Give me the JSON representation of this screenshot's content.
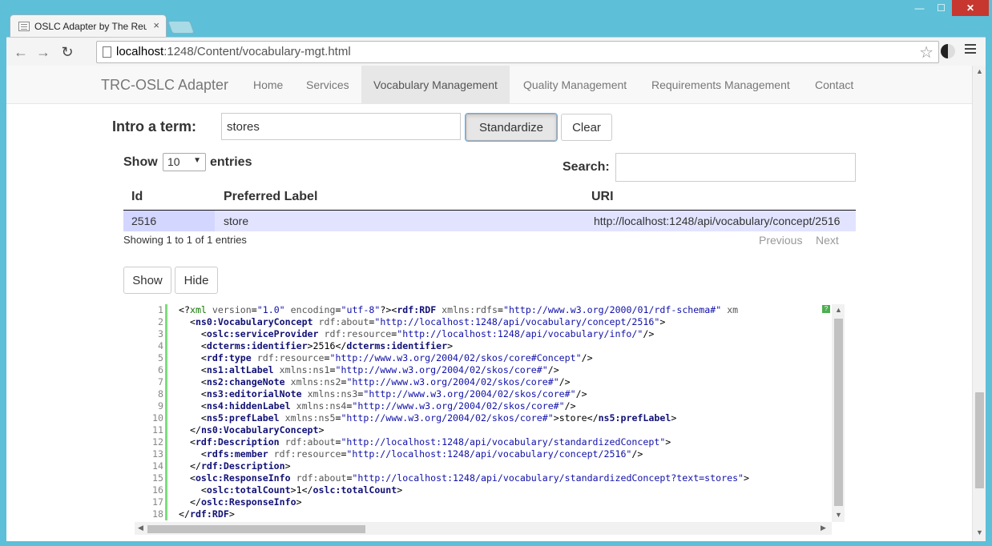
{
  "browser": {
    "tab_title": "OSLC Adapter by The Reu",
    "tab_close": "×",
    "url_host": "localhost",
    "url_rest": ":1248/Content/vocabulary-mgt.html",
    "win_min": "—",
    "win_max": "☐",
    "win_close": "✕",
    "back": "←",
    "forward": "→",
    "reload": "↻",
    "star": "☆"
  },
  "navbar": {
    "brand": "TRC-OSLC Adapter",
    "items": [
      {
        "label": "Home"
      },
      {
        "label": "Services"
      },
      {
        "label": "Vocabulary Management"
      },
      {
        "label": "Quality Management"
      },
      {
        "label": "Requirements Management"
      },
      {
        "label": "Contact"
      }
    ]
  },
  "term": {
    "label": "Intro a term:",
    "value": "stores",
    "standardize": "Standardize",
    "clear": "Clear"
  },
  "table": {
    "show_label": "Show",
    "page_size": "10",
    "entries_label": "entries",
    "search_label": "Search:",
    "columns": [
      "Id",
      "Preferred Label",
      "URI"
    ],
    "rows": [
      {
        "id": "2516",
        "label": "store",
        "uri": "http://localhost:1248/api/vocabulary/concept/2516"
      }
    ],
    "info": "Showing 1 to 1 of 1 entries",
    "previous": "Previous",
    "next": "Next"
  },
  "rdf_buttons": {
    "show": "Show",
    "hide": "Hide"
  },
  "code": {
    "line_numbers": [
      "1",
      "2",
      "3",
      "4",
      "5",
      "6",
      "7",
      "8",
      "9",
      "10",
      "11",
      "12",
      "13",
      "14",
      "15",
      "16",
      "17",
      "18"
    ],
    "lines": [
      "<?xml version=\"1.0\" encoding=\"utf-8\"?><rdf:RDF xmlns:rdfs=\"http://www.w3.org/2000/01/rdf-schema#\" xm",
      "  <ns0:VocabularyConcept rdf:about=\"http://localhost:1248/api/vocabulary/concept/2516\">",
      "    <oslc:serviceProvider rdf:resource=\"http://localhost:1248/api/vocabulary/info/\"/>",
      "    <dcterms:identifier>2516</dcterms:identifier>",
      "    <rdf:type rdf:resource=\"http://www.w3.org/2004/02/skos/core#Concept\"/>",
      "    <ns1:altLabel xmlns:ns1=\"http://www.w3.org/2004/02/skos/core#\"/>",
      "    <ns2:changeNote xmlns:ns2=\"http://www.w3.org/2004/02/skos/core#\"/>",
      "    <ns3:editorialNote xmlns:ns3=\"http://www.w3.org/2004/02/skos/core#\"/>",
      "    <ns4:hiddenLabel xmlns:ns4=\"http://www.w3.org/2004/02/skos/core#\"/>",
      "    <ns5:prefLabel xmlns:ns5=\"http://www.w3.org/2004/02/skos/core#\">store</ns5:prefLabel>",
      "  </ns0:VocabularyConcept>",
      "  <rdf:Description rdf:about=\"http://localhost:1248/api/vocabulary/standardizedConcept\">",
      "    <rdfs:member rdf:resource=\"http://localhost:1248/api/vocabulary/concept/2516\"/>",
      "  </rdf:Description>",
      "  <oslc:ResponseInfo rdf:about=\"http://localhost:1248/api/vocabulary/standardizedConcept?text=stores\">",
      "    <oslc:totalCount>1</oslc:totalCount>",
      "  </oslc:ResponseInfo>",
      "</rdf:RDF>"
    ]
  },
  "colors": {
    "titlebar": "#5dbfd8",
    "close_button": "#c7372f",
    "selected_row": "#e2e4ff",
    "gutter_marker": "#7ddc7d"
  }
}
